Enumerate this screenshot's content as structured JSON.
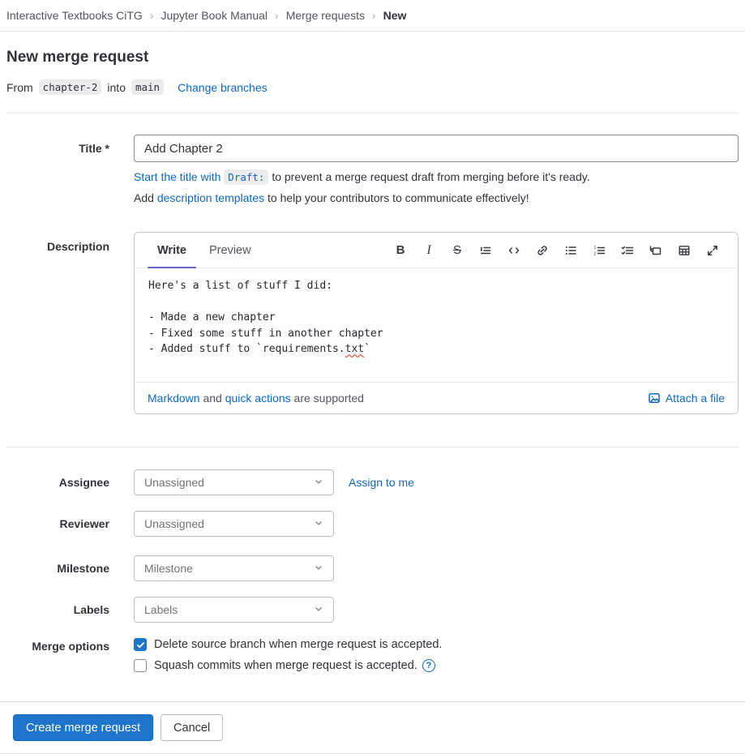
{
  "breadcrumb": {
    "items": [
      "Interactive Textbooks CiTG",
      "Jupyter Book Manual",
      "Merge requests"
    ],
    "current": "New",
    "separator": "›"
  },
  "page": {
    "title": "New merge request"
  },
  "branch_line": {
    "from_label": "From",
    "source_branch": "chapter-2",
    "into_label": "into",
    "target_branch": "main",
    "change_branches_label": "Change branches"
  },
  "title_field": {
    "label": "Title *",
    "value": "Add Chapter 2",
    "hint1_link": "Start the title with",
    "hint1_code": "Draft:",
    "hint1_rest": " to prevent a merge request draft from merging before it's ready.",
    "hint2_prefix": "Add ",
    "hint2_link": "description templates",
    "hint2_suffix": " to help your contributors to communicate effectively!"
  },
  "description": {
    "label": "Description",
    "tabs": {
      "write": "Write",
      "preview": "Preview"
    },
    "toolbar_glyphs": {
      "bold": "B",
      "italic": "I",
      "strikethrough": "S"
    },
    "lines": {
      "0": "Here's a list of stuff I did:",
      "1": "",
      "2": "- Made a new chapter",
      "3": "- Fixed some stuff in another chapter",
      "4_prefix": "- Added stuff to `requirements.",
      "4_misspelled": "txt",
      "4_suffix": "`"
    },
    "footer": {
      "markdown_link": "Markdown",
      "and_text": " and ",
      "quick_actions_link": "quick actions",
      "supported_text": " are supported",
      "attach_label": "Attach a file"
    }
  },
  "fields": {
    "assignee": {
      "label": "Assignee",
      "value": "Unassigned",
      "action": "Assign to me"
    },
    "reviewer": {
      "label": "Reviewer",
      "value": "Unassigned"
    },
    "milestone": {
      "label": "Milestone",
      "value": "Milestone"
    },
    "labels": {
      "label": "Labels",
      "value": "Labels"
    }
  },
  "merge_options": {
    "label": "Merge options",
    "delete_source": {
      "label": "Delete source branch when merge request is accepted.",
      "checked": true
    },
    "squash": {
      "label": "Squash commits when merge request is accepted.",
      "checked": false,
      "help_glyph": "?"
    }
  },
  "actions": {
    "submit": "Create merge request",
    "cancel": "Cancel"
  },
  "colors": {
    "link": "#1068bf",
    "primary_button": "#1f75cb",
    "checkbox_checked": "#1f75cb",
    "active_tab_underline": "#6666c4",
    "code_chip_bg": "#ececef",
    "spellcheck_underline": "#dd2b0e"
  }
}
